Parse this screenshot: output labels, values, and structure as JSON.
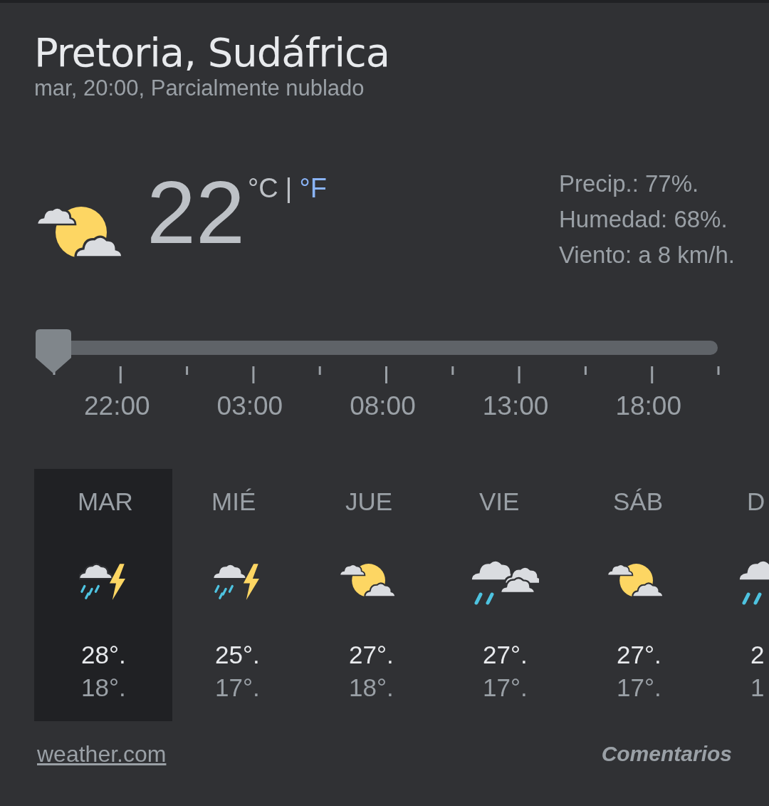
{
  "location": "Pretoria, Sudáfrica",
  "subtitle": "mar, 20:00, Parcialmente nublado",
  "current": {
    "kind": "partly",
    "temperature": "22",
    "unit_c": "°C",
    "separator": "|",
    "unit_f": "°F",
    "unit_c_selected": true
  },
  "details": [
    "Precip.: 77%.",
    "Humedad: 68%.",
    "Viento: a 8 km/h."
  ],
  "slider": {
    "level": 0
  },
  "time_labels": [
    "22:00",
    "03:00",
    "08:00",
    "13:00",
    "18:00"
  ],
  "days": [
    {
      "day": "MAR",
      "kind": "storm",
      "high": "28°.",
      "low": "18°.",
      "selected": true
    },
    {
      "day": "MIÉ",
      "kind": "storm",
      "high": "25°.",
      "low": "17°.",
      "selected": false
    },
    {
      "day": "JUE",
      "kind": "partly",
      "high": "27°.",
      "low": "18°.",
      "selected": false
    },
    {
      "day": "VIE",
      "kind": "rain",
      "high": "27°.",
      "low": "17°.",
      "selected": false
    },
    {
      "day": "SÁB",
      "kind": "partly",
      "high": "27°.",
      "low": "17°.",
      "selected": false
    },
    {
      "day": "D",
      "kind": "rain",
      "high": "2",
      "low": "1",
      "selected": false
    }
  ],
  "source_link": "weather.com",
  "feedback_link": "Comentarios"
}
